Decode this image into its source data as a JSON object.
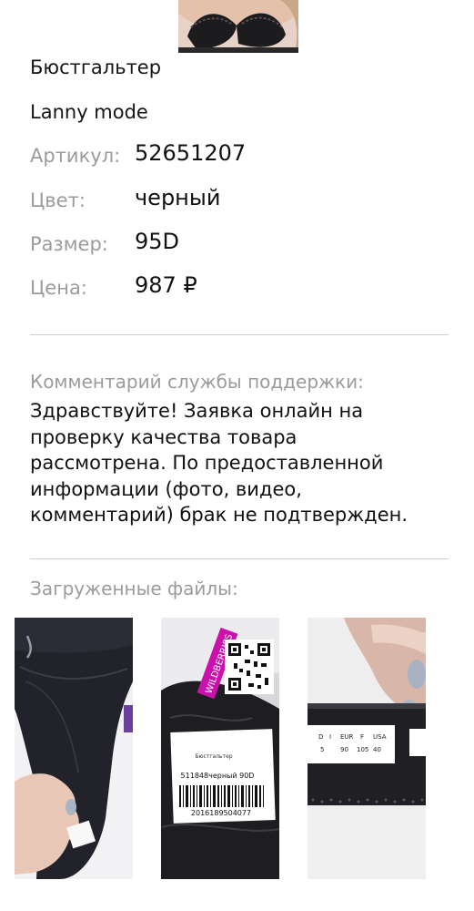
{
  "product": {
    "image_icon": "bra-product-photo",
    "name": "Бюстгальтер",
    "brand": "Lanny mode",
    "specs": [
      {
        "label": "Артикул:",
        "value": "52651207"
      },
      {
        "label": "Цвет:",
        "value": "черный"
      },
      {
        "label": "Размер:",
        "value": "95D"
      },
      {
        "label": "Цена:",
        "value": "987 ₽"
      }
    ]
  },
  "support": {
    "title": "Комментарий службы поддержки:",
    "lines": [
      "Здравствуйте! Заявка онлайн на",
      "проверку качества товара",
      "рассмотрена. По предоставленной",
      "информации (фото, видео,",
      "комментарий) брак не подтвержден."
    ]
  },
  "files": {
    "title": "Загруженные файлы:",
    "items": [
      {
        "icon": "bra-closeup-photo"
      },
      {
        "icon": "package-label-photo",
        "tag_brand": "WILDBERRIES",
        "label_title": "Бюстгальтер",
        "label_sku": "511848черный 90D",
        "label_barcode": "2016189504077"
      },
      {
        "icon": "size-tag-photo",
        "size_headers": [
          "D",
          "I",
          "EUR",
          "F",
          "USA"
        ],
        "size_values": [
          "5",
          "90",
          "105",
          "40"
        ]
      }
    ]
  }
}
